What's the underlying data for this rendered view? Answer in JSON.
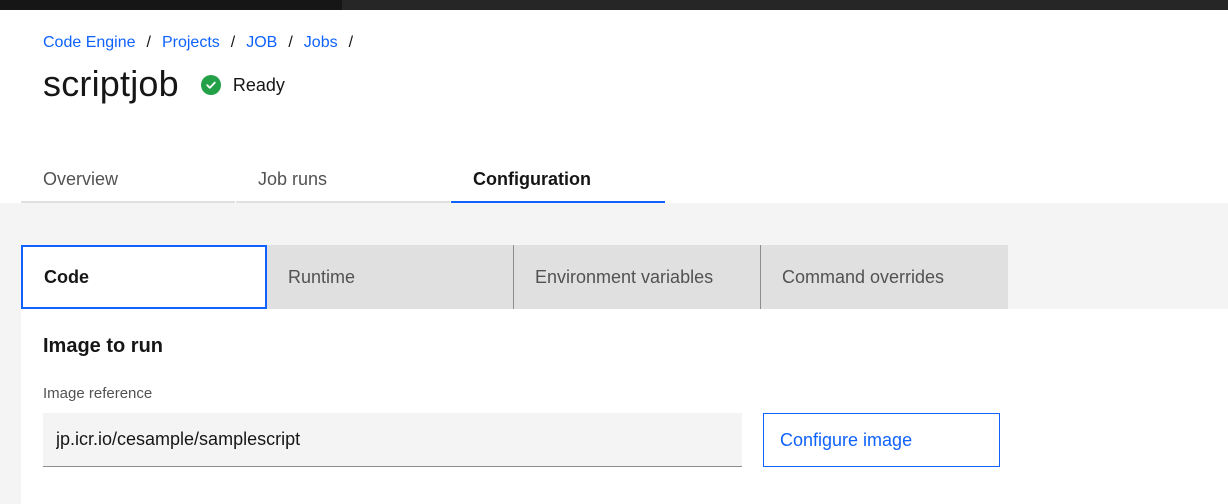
{
  "breadcrumb": {
    "items": [
      "Code Engine",
      "Projects",
      "JOB",
      "Jobs"
    ],
    "separator": "/"
  },
  "page": {
    "title": "scriptjob",
    "status": {
      "label": "Ready",
      "color": "#24a148",
      "icon": "check-circle-icon"
    }
  },
  "tabs": [
    {
      "label": "Overview",
      "active": false
    },
    {
      "label": "Job runs",
      "active": false
    },
    {
      "label": "Configuration",
      "active": true
    }
  ],
  "subtabs": [
    {
      "label": "Code",
      "active": true
    },
    {
      "label": "Runtime",
      "active": false
    },
    {
      "label": "Environment variables",
      "active": false
    },
    {
      "label": "Command overrides",
      "active": false
    }
  ],
  "code": {
    "section_title": "Image to run",
    "image_reference_label": "Image reference",
    "image_reference_value": "jp.icr.io/cesample/samplescript",
    "configure_button": "Configure image"
  },
  "colors": {
    "accent": "#0f62fe",
    "success": "#24a148"
  }
}
